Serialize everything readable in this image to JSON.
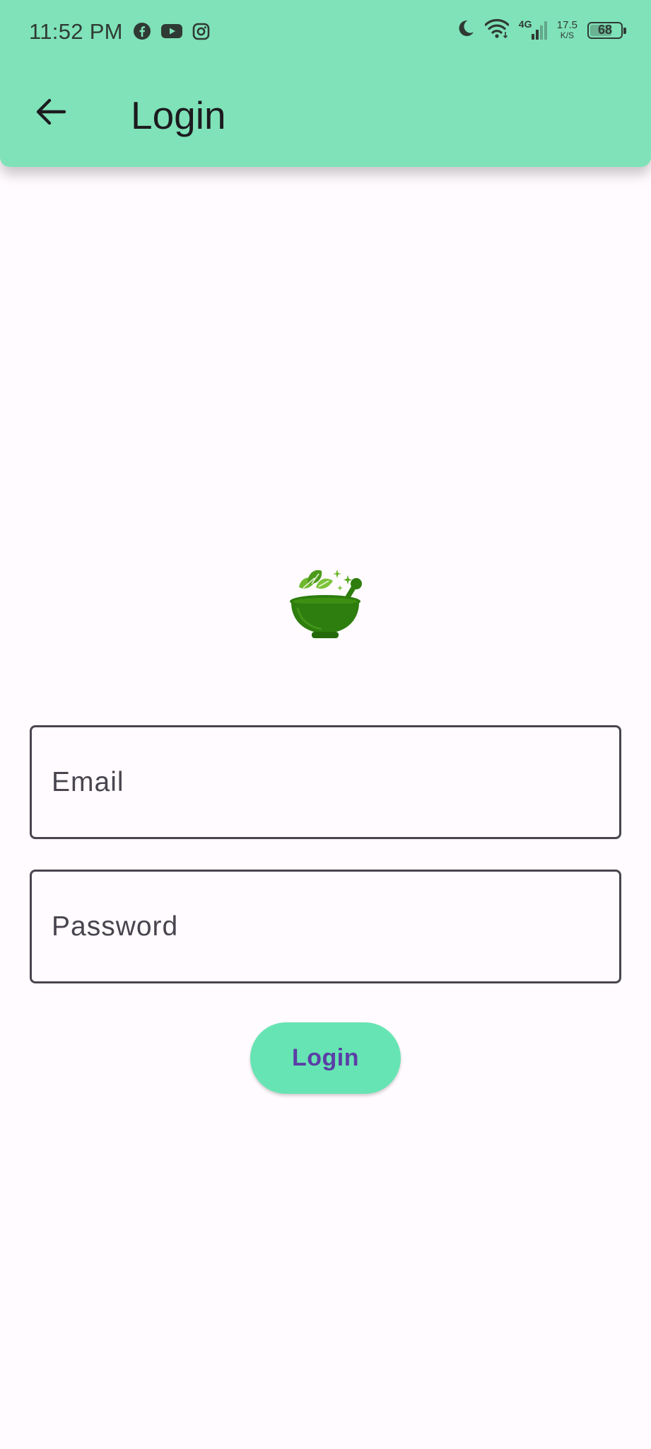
{
  "status_bar": {
    "time": "11:52 PM",
    "notification_icons": [
      "facebook-icon",
      "youtube-icon",
      "instagram-icon"
    ],
    "network_type": "4G",
    "net_speed_value": "17.5",
    "net_speed_unit": "K/S",
    "battery_level": "68"
  },
  "app_bar": {
    "back_icon": "arrow-left-icon",
    "title": "Login",
    "background_color": "#80e2b8"
  },
  "logo": {
    "icon": "mortar-pestle-herbs-icon",
    "color": "#2e7d0f"
  },
  "form": {
    "email_label": "Email",
    "password_label": "Password",
    "login_button_label": "Login",
    "button_color": "#67e4b3",
    "button_text_color": "#5b3ea6"
  }
}
